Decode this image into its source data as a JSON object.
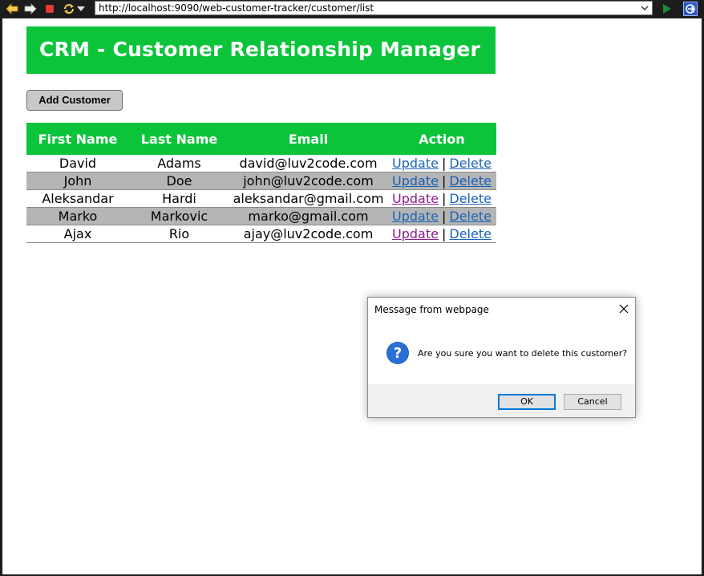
{
  "browser": {
    "url": "http://localhost:9090/web-customer-tracker/customer/list",
    "icons": [
      "back-icon",
      "forward-icon",
      "stop-icon",
      "refresh-icon",
      "dropdown-icon",
      "go-icon",
      "extension-icon"
    ]
  },
  "page": {
    "title": "CRM - Customer Relationship Manager",
    "add_button_label": "Add Customer",
    "accent_color": "#0cc43a"
  },
  "table": {
    "headers": {
      "first_name": "First Name",
      "last_name": "Last Name",
      "email": "Email",
      "action": "Action"
    },
    "update_label": "Update",
    "delete_label": "Delete",
    "separator": "|",
    "rows": [
      {
        "first_name": "David",
        "last_name": "Adams",
        "email": "david@luv2code.com"
      },
      {
        "first_name": "John",
        "last_name": "Doe",
        "email": "john@luv2code.com"
      },
      {
        "first_name": "Aleksandar",
        "last_name": "Hardi",
        "email": "aleksandar@gmail.com"
      },
      {
        "first_name": "Marko",
        "last_name": "Markovic",
        "email": "marko@gmail.com"
      },
      {
        "first_name": "Ajax",
        "last_name": "Rio",
        "email": "ajay@luv2code.com"
      }
    ]
  },
  "dialog": {
    "title": "Message from webpage",
    "message": "Are you sure you want to delete this customer?",
    "ok_label": "OK",
    "cancel_label": "Cancel",
    "icon": "question-icon"
  }
}
